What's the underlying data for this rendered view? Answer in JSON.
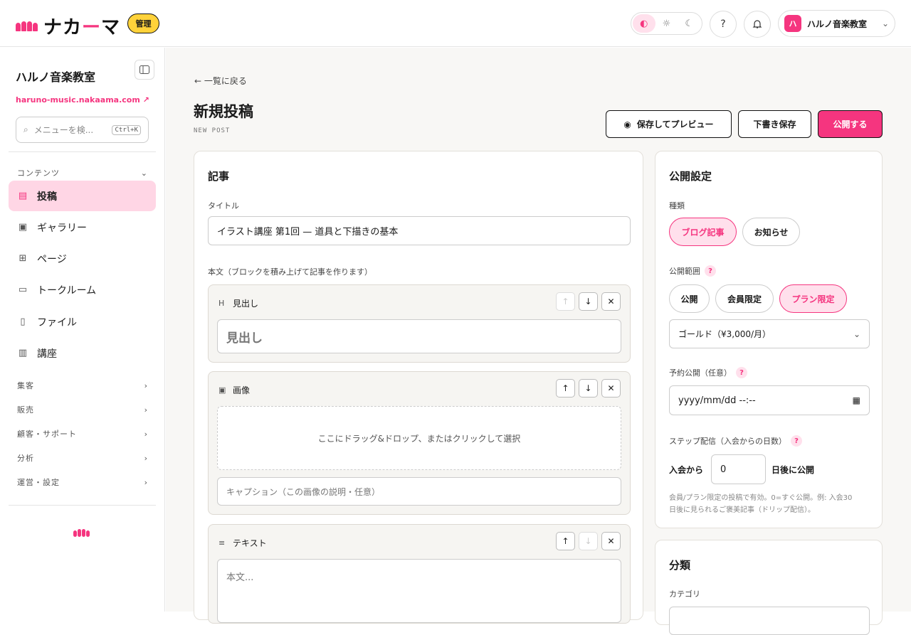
{
  "app": {
    "brand_left": "ナカ",
    "brand_accent": "ー",
    "brand_right": "マ",
    "admin_badge": "管理",
    "account_name": "ハルノ音楽教室",
    "account_initial": "ハ"
  },
  "sidebar": {
    "title": "ハルノ音楽教室",
    "url": "haruno-music.nakaama.com",
    "search_placeholder": "メニューを検...",
    "search_shortcut": "Ctrl+K",
    "content_section": "コンテンツ",
    "items": [
      {
        "label": "投稿",
        "icon": "document-icon",
        "active": true
      },
      {
        "label": "ギャラリー",
        "icon": "image-icon"
      },
      {
        "label": "ページ",
        "icon": "pages-icon"
      },
      {
        "label": "トークルーム",
        "icon": "chat-icon"
      },
      {
        "label": "ファイル",
        "icon": "file-icon"
      },
      {
        "label": "講座",
        "icon": "book-icon"
      }
    ],
    "sections": [
      "集客",
      "販売",
      "顧客・サポート",
      "分析",
      "運営・設定"
    ]
  },
  "main": {
    "back_label": "← 一覧に戻る",
    "page_title": "新規投稿",
    "page_subtitle": "NEW POST",
    "buttons": {
      "preview": "保存してプレビュー",
      "draft": "下書き保存",
      "publish": "公開する"
    }
  },
  "article": {
    "heading": "記事",
    "title_label": "タイトル",
    "title_value": "イラスト講座 第1回 — 道具と下描きの基本",
    "body_label": "本文（ブロックを積み上げて記事を作ります）",
    "blocks": {
      "heading_block": {
        "label": "見出し",
        "placeholder": "見出し"
      },
      "image_block": {
        "label": "画像",
        "drop_text": "ここにドラッグ&ドロップ、またはクリックして選択",
        "caption_placeholder": "キャプション（この画像の説明・任意）"
      },
      "text_block": {
        "label": "テキスト",
        "placeholder": "本文..."
      }
    }
  },
  "publish_settings": {
    "heading": "公開設定",
    "type_label": "種類",
    "types": [
      "ブログ記事",
      "お知らせ"
    ],
    "type_selected": "ブログ記事",
    "scope_label": "公開範囲",
    "scopes": [
      "公開",
      "会員限定",
      "プラン限定"
    ],
    "scope_selected": "プラン限定",
    "plan_value": "ゴールド（¥3,000/月）",
    "schedule_label": "予約公開（任意）",
    "schedule_placeholder": "yyyy/mm/dd --:--",
    "step_label": "ステップ配信（入会からの日数）",
    "step_prefix": "入会から",
    "step_value": "0",
    "step_suffix": "日後に公開",
    "step_note_1": "会員/プラン限定の投稿で有効。0=すぐ公開。例: 入会30",
    "step_note_2": "日後に見られるご褒美記事（ドリップ配信）。"
  },
  "classification": {
    "heading": "分類",
    "category_label": "カテゴリ"
  },
  "colors": {
    "accent": "#f5357f",
    "badge": "#ffd23a",
    "active_bg": "#ffd6e5"
  }
}
